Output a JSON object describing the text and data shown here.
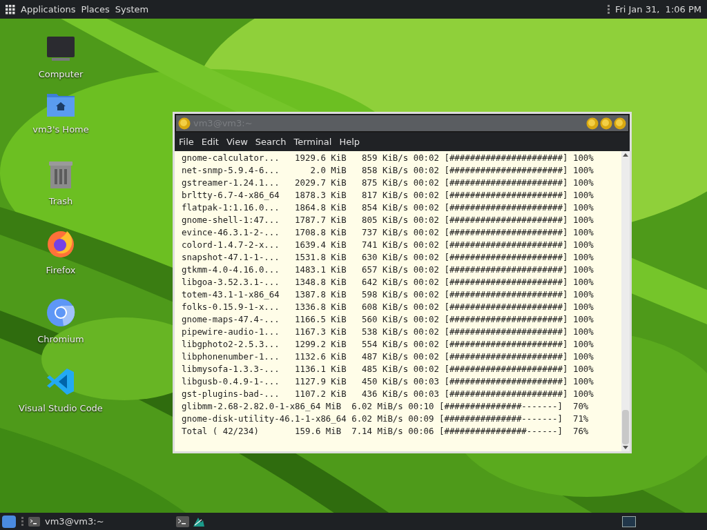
{
  "top_panel": {
    "menus": [
      "Applications",
      "Places",
      "System"
    ],
    "clock": "Fri Jan 31,  1:06 PM"
  },
  "desktop_icons": [
    {
      "kind": "computer",
      "label": "Computer"
    },
    {
      "kind": "home",
      "label": "vm3's Home"
    },
    {
      "kind": "trash",
      "label": "Trash"
    },
    {
      "kind": "firefox",
      "label": "Firefox"
    },
    {
      "kind": "chromium",
      "label": "Chromium"
    },
    {
      "kind": "vscode",
      "label": "Visual Studio Code"
    }
  ],
  "terminal": {
    "title": "vm3@vm3:~",
    "menu": [
      "File",
      "Edit",
      "View",
      "Search",
      "Terminal",
      "Help"
    ],
    "lines": [
      "gnome-calculator...   1929.6 KiB   859 KiB/s 00:02 [######################] 100%",
      "net-snmp-5.9.4-6...      2.0 MiB   858 KiB/s 00:02 [######################] 100%",
      "gstreamer-1.24.1...   2029.7 KiB   875 KiB/s 00:02 [######################] 100%",
      "brltty-6.7-4-x86_64   1878.3 KiB   817 KiB/s 00:02 [######################] 100%",
      "flatpak-1:1.16.0...   1864.8 KiB   854 KiB/s 00:02 [######################] 100%",
      "gnome-shell-1:47...   1787.7 KiB   805 KiB/s 00:02 [######################] 100%",
      "evince-46.3.1-2-...   1708.8 KiB   737 KiB/s 00:02 [######################] 100%",
      "colord-1.4.7-2-x...   1639.4 KiB   741 KiB/s 00:02 [######################] 100%",
      "snapshot-47.1-1-...   1531.8 KiB   630 KiB/s 00:02 [######################] 100%",
      "gtkmm-4.0-4.16.0...   1483.1 KiB   657 KiB/s 00:02 [######################] 100%",
      "libgoa-3.52.3.1-...   1348.8 KiB   642 KiB/s 00:02 [######################] 100%",
      "totem-43.1-1-x86_64   1387.8 KiB   598 KiB/s 00:02 [######################] 100%",
      "folks-0.15.9-1-x...   1336.8 KiB   608 KiB/s 00:02 [######################] 100%",
      "gnome-maps-47.4-...   1166.5 KiB   560 KiB/s 00:02 [######################] 100%",
      "pipewire-audio-1...   1167.3 KiB   538 KiB/s 00:02 [######################] 100%",
      "libgphoto2-2.5.3...   1299.2 KiB   554 KiB/s 00:02 [######################] 100%",
      "libphonenumber-1...   1132.6 KiB   487 KiB/s 00:02 [######################] 100%",
      "libmysofa-1.3.3-...   1136.1 KiB   485 KiB/s 00:02 [######################] 100%",
      "libgusb-0.4.9-1-...   1127.9 KiB   450 KiB/s 00:03 [######################] 100%",
      "gst-plugins-bad-...   1107.2 KiB   436 KiB/s 00:03 [######################] 100%",
      "glibmm-2.68-2.82.0-1-x86_64 MiB  6.02 MiB/s 00:10 [###############-------]  70%",
      "gnome-disk-utility-46.1-1-x86_64 6.02 MiB/s 00:09 [###############-------]  71%",
      "Total ( 42/234)       159.6 MiB  7.14 MiB/s 00:06 [################------]  76%"
    ]
  },
  "taskbar": {
    "window_label": "vm3@vm3:~"
  }
}
